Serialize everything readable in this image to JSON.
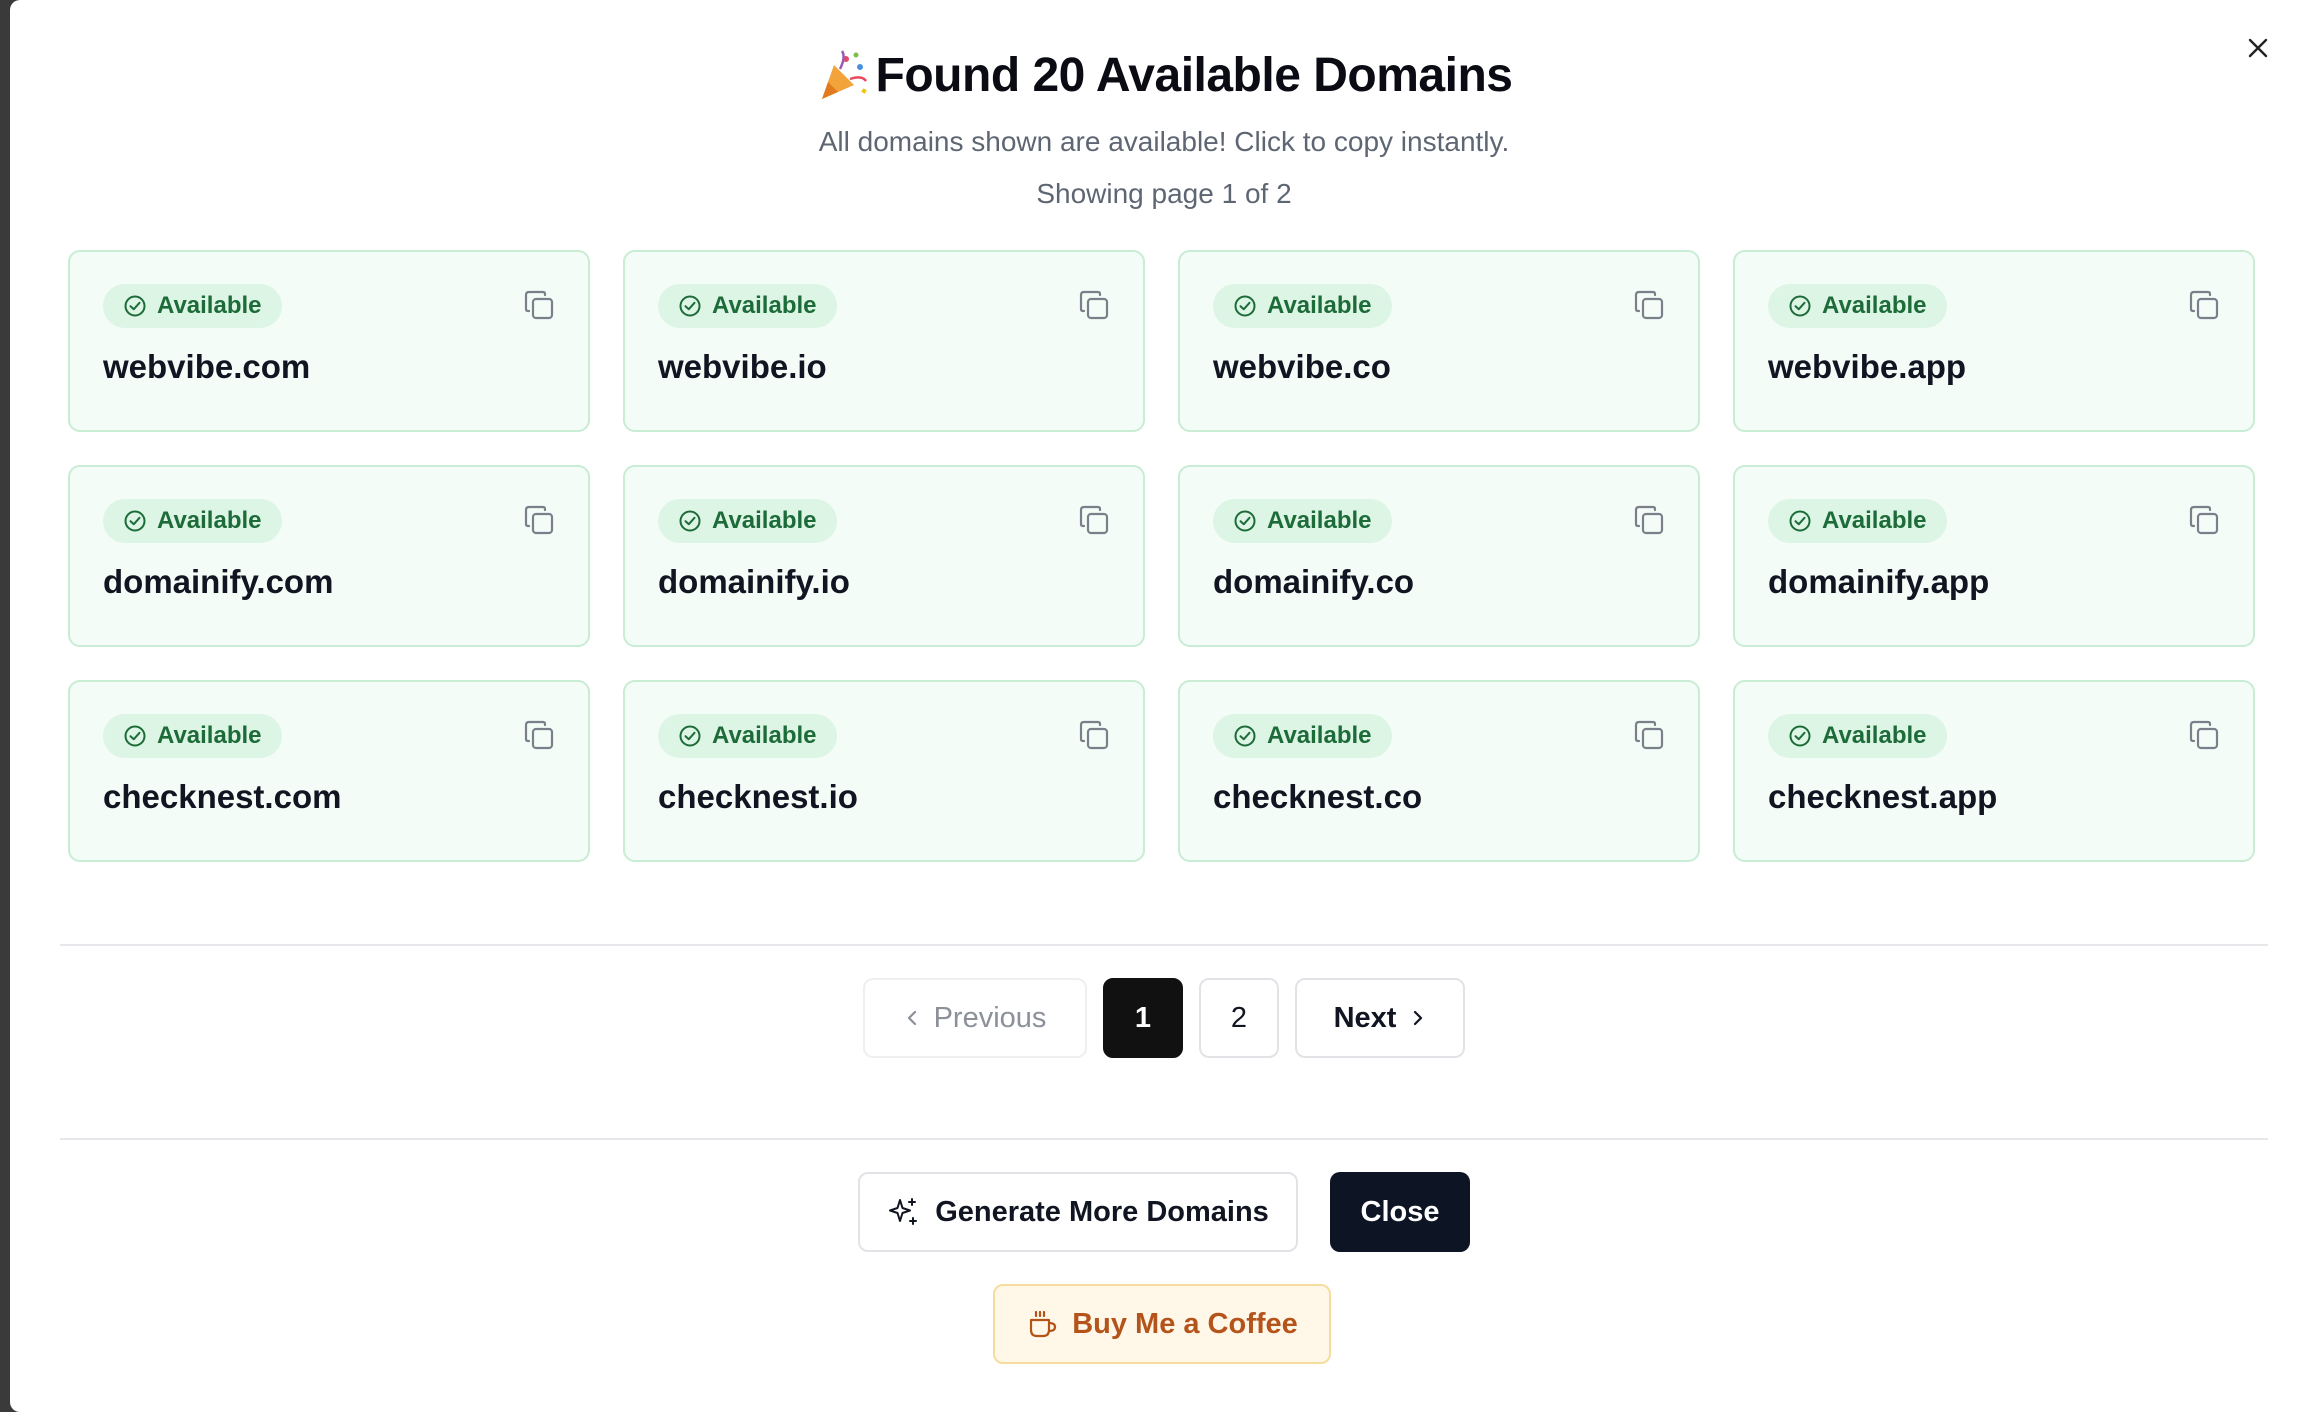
{
  "modal": {
    "title": "Found 20 Available Domains",
    "subtitle": "All domains shown are available! Click to copy instantly.",
    "page_info": "Showing page 1 of 2",
    "close_icon": "close-icon",
    "title_icon": "party-popper-icon"
  },
  "badge_label": "Available",
  "domains": [
    "webvibe.com",
    "webvibe.io",
    "webvibe.co",
    "webvibe.app",
    "domainify.com",
    "domainify.io",
    "domainify.co",
    "domainify.app",
    "checknest.com",
    "checknest.io",
    "checknest.co",
    "checknest.app"
  ],
  "pagination": {
    "previous_label": "Previous",
    "next_label": "Next",
    "pages": [
      "1",
      "2"
    ],
    "current_page": "1"
  },
  "actions": {
    "generate_label": "Generate More Domains",
    "close_label": "Close",
    "coffee_label": "Buy Me a Coffee"
  },
  "colors": {
    "card_bg": "#f4fcf7",
    "card_border": "#c8ecd4",
    "badge_text": "#1e6b3a",
    "primary_dark": "#0d1424",
    "coffee_text": "#b5541a",
    "coffee_bg": "#fff8e8"
  }
}
